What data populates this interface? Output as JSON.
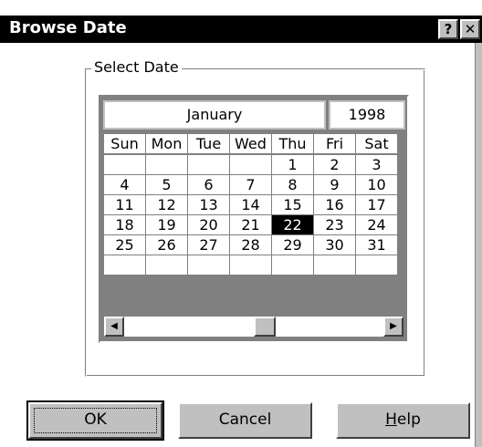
{
  "window": {
    "title": "Browse Date",
    "help_label": "?",
    "close_label": "✕"
  },
  "group": {
    "label": "Select Date"
  },
  "calendar": {
    "month": "January",
    "year": "1998",
    "weekdays": [
      "Sun",
      "Mon",
      "Tue",
      "Wed",
      "Thu",
      "Fri",
      "Sat"
    ],
    "weeks": [
      [
        "",
        "",
        "",
        "",
        "1",
        "2",
        "3"
      ],
      [
        "4",
        "5",
        "6",
        "7",
        "8",
        "9",
        "10"
      ],
      [
        "11",
        "12",
        "13",
        "14",
        "15",
        "16",
        "17"
      ],
      [
        "18",
        "19",
        "20",
        "21",
        "22",
        "23",
        "24"
      ],
      [
        "25",
        "26",
        "27",
        "28",
        "29",
        "30",
        "31"
      ],
      [
        "",
        "",
        "",
        "",
        "",
        "",
        ""
      ]
    ],
    "selected_day": "22"
  },
  "scrollbar": {
    "left_arrow": "◀",
    "right_arrow": "▶"
  },
  "buttons": {
    "ok": "OK",
    "cancel": "Cancel",
    "help": "Help"
  },
  "colors": {
    "titlebar": "#000000",
    "face": "#c0c0c0",
    "selected_bg": "#000000"
  }
}
